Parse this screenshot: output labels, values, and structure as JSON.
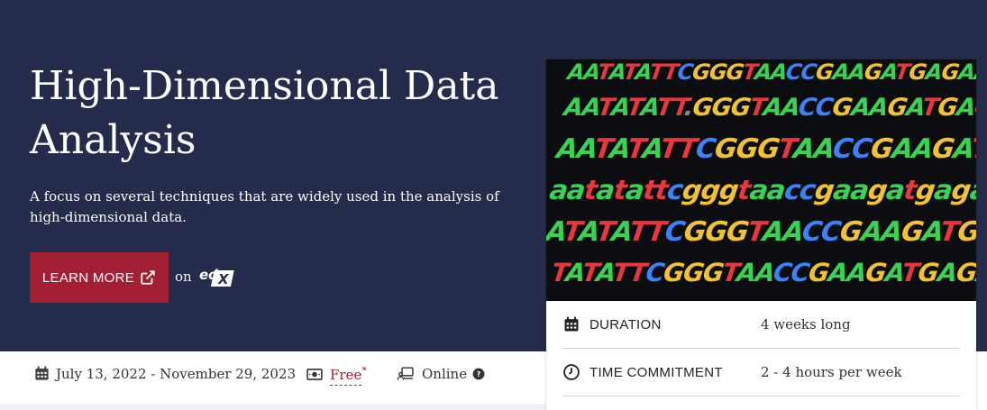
{
  "course": {
    "title": "High-Dimensional Data Analysis",
    "description": "A focus on several techniques that are widely used in the analysis of high-dimensional data.",
    "learn_more_label": "LEARN MORE",
    "on_label": "on",
    "provider_logo": "edX"
  },
  "info_bar": {
    "dates": "July 13, 2022 - November 29, 2023",
    "price": "Free",
    "price_marker": "*",
    "format": "Online"
  },
  "details": [
    {
      "label": "DURATION",
      "value": "4 weeks long",
      "icon": "calendar-icon"
    },
    {
      "label": "TIME COMMITMENT",
      "value": "2 - 4 hours per week",
      "icon": "clock-icon"
    }
  ],
  "image": {
    "description_icon": "dna-sequence-photo",
    "dna_lines": [
      "AATATATTCGGGTAACCGAAGATGAGAACGATGAGCCCATTGAAAT",
      "AATATATT.GGGTAACCGAAGATGAGAACGATGAGCCCATTGAAAT",
      "AATATATTCGGGTAACCGAAGATGAGAACGATGAGCCCATTGAAAT",
      "aatatattcgggtaaccgaagatgagaacgatgagcccattgaaat",
      "ATATATTCGGGTAACCGAAGATGAGAACGATGAGCCCATTGAAAT",
      "TATATTCGGGTAACCGAAGATGAGAACGATGAGCCCATTGAAATA"
    ]
  },
  "colors": {
    "hero_bg": "#252b4b",
    "brand_red": "#a31f34",
    "A": "#39d353",
    "T": "#e8383d",
    "C": "#3b82f6",
    "G": "#f2c230"
  }
}
